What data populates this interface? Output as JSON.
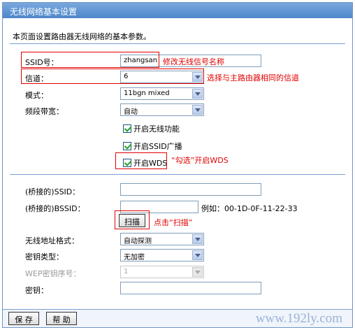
{
  "window": {
    "title": "无线网络基本设置"
  },
  "page": {
    "description": "本页面设置路由器无线网络的基本参数。"
  },
  "form": {
    "ssid": {
      "label": "SSID号：",
      "value": "zhangsan"
    },
    "channel": {
      "label": "信道：",
      "value": "6"
    },
    "mode": {
      "label": "模式：",
      "value": "11bgn mixed"
    },
    "bandwidth": {
      "label": "频段带宽：",
      "value": "自动"
    },
    "enable_wireless": {
      "label": "开启无线功能",
      "checked": true
    },
    "enable_ssid_broadcast": {
      "label": "开启SSID广播",
      "checked": true
    },
    "enable_wds": {
      "label": "开启WDS",
      "checked": true
    },
    "bridge_ssid": {
      "label": "(桥接的)SSID：",
      "value": ""
    },
    "bridge_bssid": {
      "label": "(桥接的)BSSID：",
      "value": "",
      "example": "例如：00-1D-0F-11-22-33"
    },
    "scan_button": {
      "label": "扫描"
    },
    "mac_format": {
      "label": "无线地址格式：",
      "value": "自动探测"
    },
    "key_type": {
      "label": "密钥类型：",
      "value": "无加密"
    },
    "wep_index": {
      "label": "WEP密钥序号：",
      "value": "1"
    },
    "key": {
      "label": "密钥：",
      "value": ""
    }
  },
  "footer": {
    "save_label": "保 存",
    "help_label": "帮 助",
    "watermark": "www.192ly.com"
  },
  "annotations": {
    "ssid_note": "修改无线信号名称",
    "channel_note": "选择与主路由器相同的信道",
    "wds_note": "“勾选”开启WDS",
    "scan_note": "点击“扫描”"
  },
  "colors": {
    "title_bar": "#4d86cb",
    "annotation": "#e10000",
    "border": "#7aa0d0"
  }
}
